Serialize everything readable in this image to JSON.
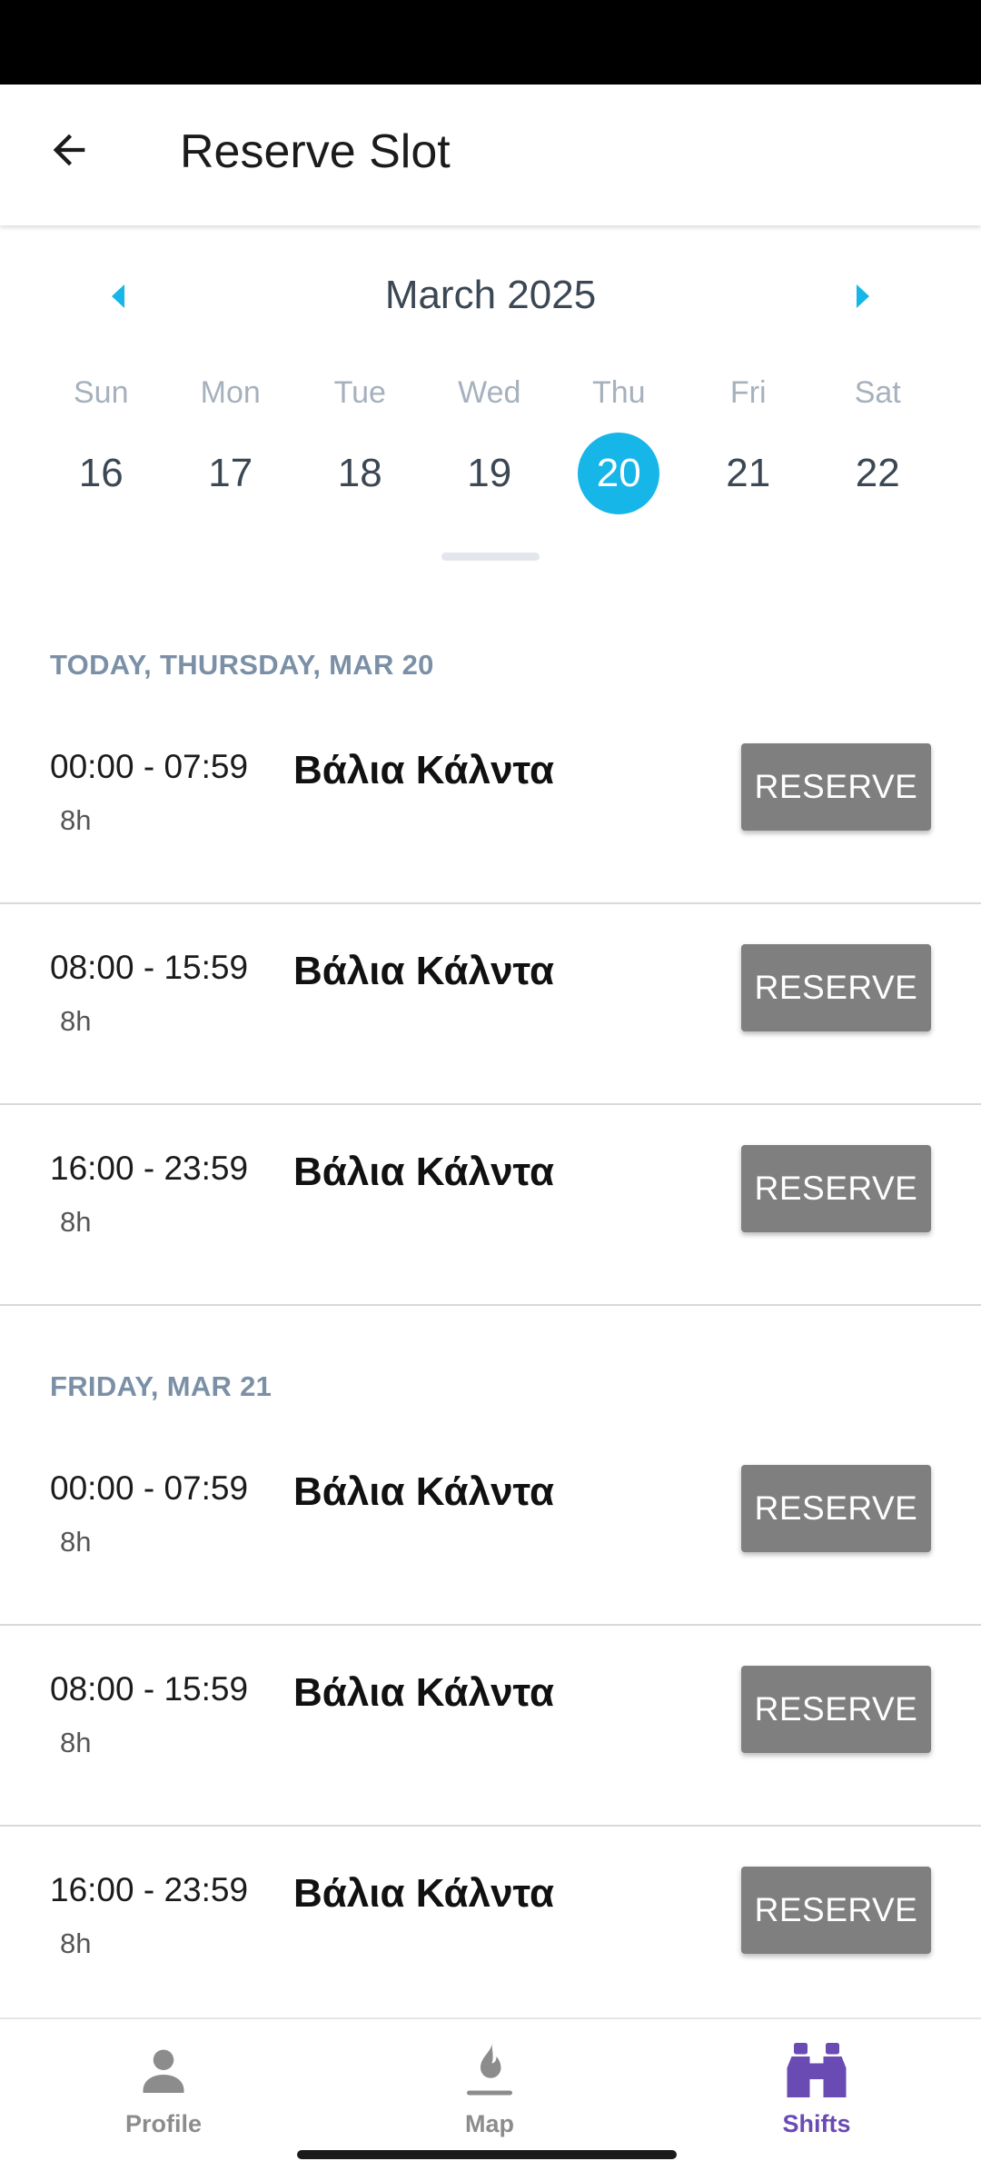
{
  "app_bar": {
    "title": "Reserve Slot",
    "back_icon": "arrow-left-icon"
  },
  "calendar": {
    "month_label": "March 2025",
    "prev_icon": "caret-left-icon",
    "next_icon": "caret-right-icon",
    "accent_color": "#16b6e8",
    "days_of_week": [
      "Sun",
      "Mon",
      "Tue",
      "Wed",
      "Thu",
      "Fri",
      "Sat"
    ],
    "dates": [
      "16",
      "17",
      "18",
      "19",
      "20",
      "21",
      "22"
    ],
    "selected_date": "20"
  },
  "sections": [
    {
      "header": "TODAY, THURSDAY, MAR 20",
      "slots": [
        {
          "time": "00:00 - 07:59",
          "duration": "8h",
          "name": "Βάλια Κάλντα",
          "button": "RESERVE"
        },
        {
          "time": "08:00 - 15:59",
          "duration": "8h",
          "name": "Βάλια Κάλντα",
          "button": "RESERVE"
        },
        {
          "time": "16:00 - 23:59",
          "duration": "8h",
          "name": "Βάλια Κάλντα",
          "button": "RESERVE"
        }
      ]
    },
    {
      "header": "FRIDAY, MAR 21",
      "slots": [
        {
          "time": "00:00 - 07:59",
          "duration": "8h",
          "name": "Βάλια Κάλντα",
          "button": "RESERVE"
        },
        {
          "time": "08:00 - 15:59",
          "duration": "8h",
          "name": "Βάλια Κάλντα",
          "button": "RESERVE"
        },
        {
          "time": "16:00 - 23:59",
          "duration": "8h",
          "name": "Βάλια Κάλντα",
          "button": "RESERVE"
        }
      ]
    }
  ],
  "bottom_nav": {
    "active_color": "#6a4ab3",
    "items": [
      {
        "label": "Profile",
        "icon": "person-icon"
      },
      {
        "label": "Map",
        "icon": "map-flame-icon"
      },
      {
        "label": "Shifts",
        "icon": "binoculars-icon",
        "active": true
      }
    ]
  }
}
